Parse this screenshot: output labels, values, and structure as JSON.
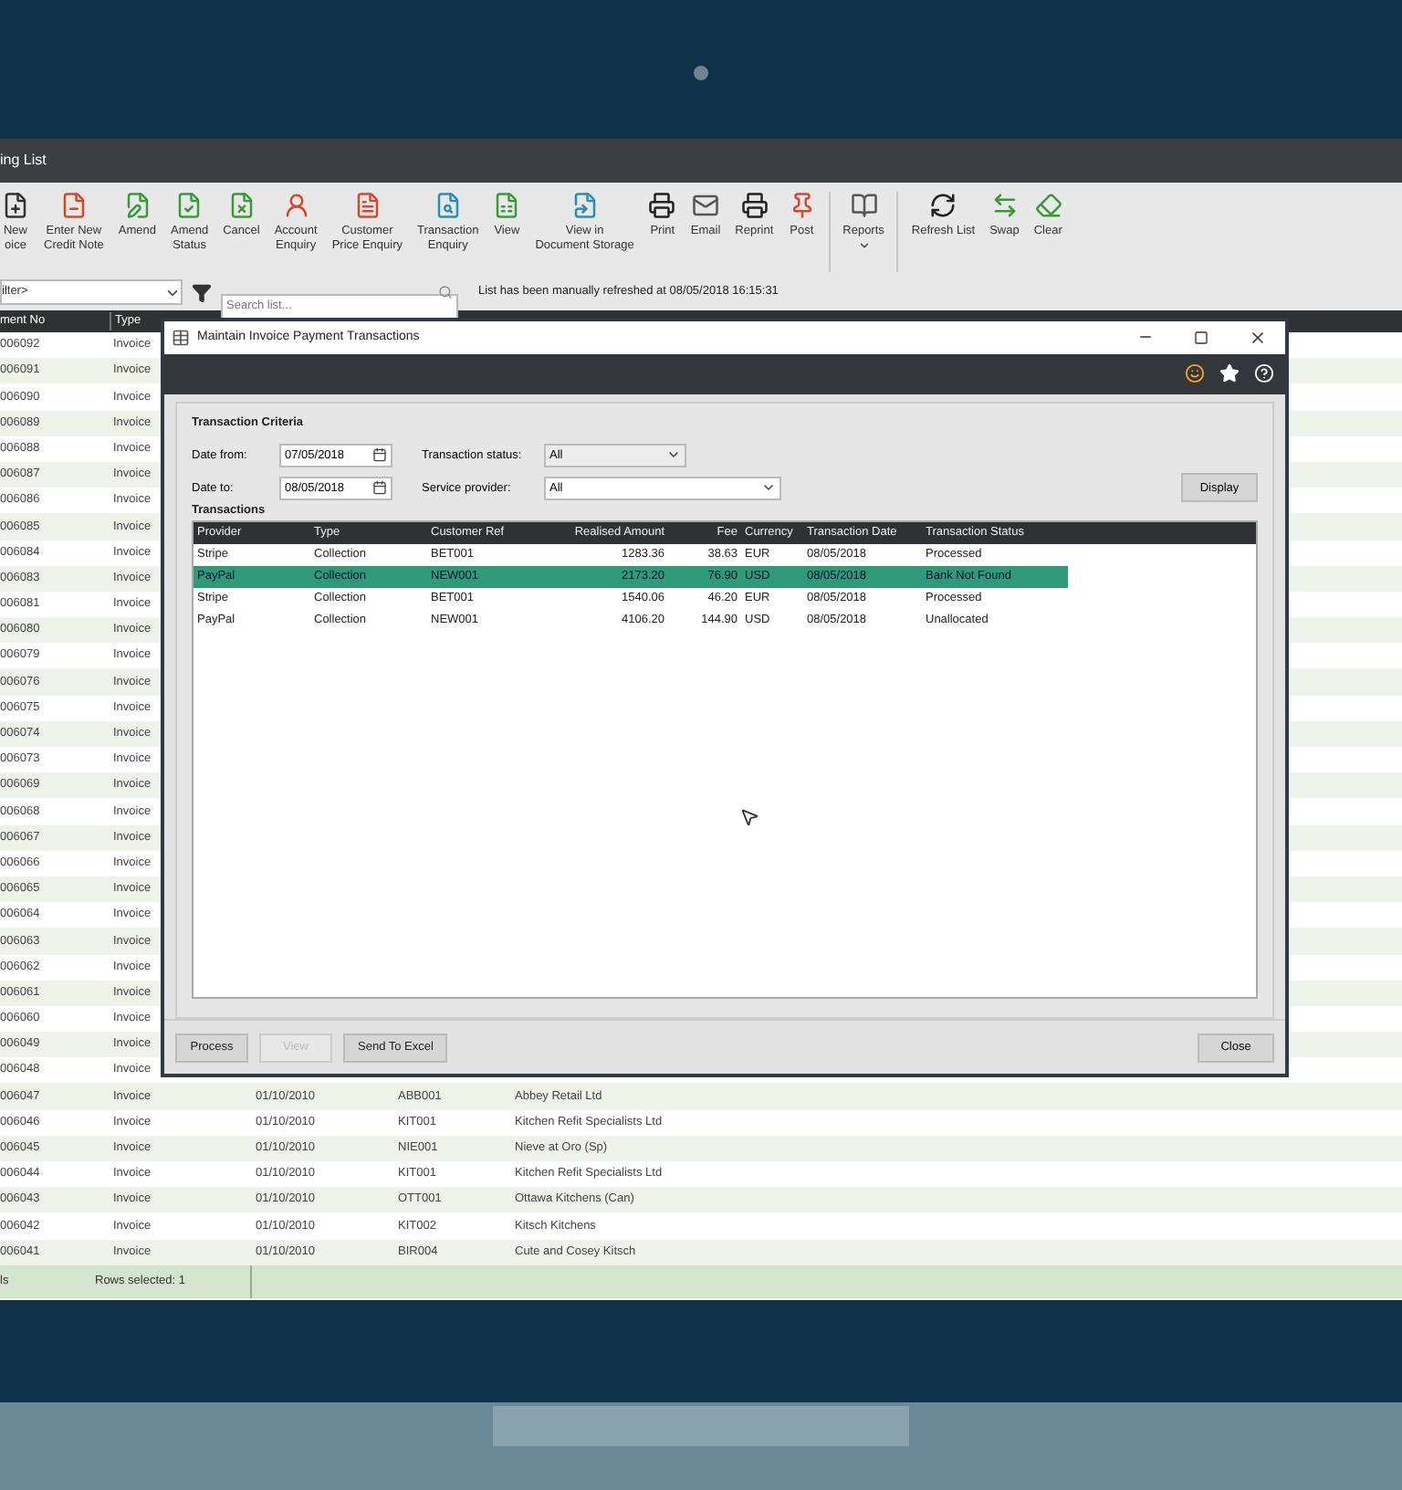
{
  "window": {
    "title": "ing List"
  },
  "toolbar": [
    {
      "label": "New\noice",
      "dropdown": false
    },
    {
      "label": "Enter New\nCredit Note",
      "dropdown": false
    },
    {
      "label": "Amend",
      "dropdown": false
    },
    {
      "label": "Amend\nStatus",
      "dropdown": false
    },
    {
      "label": "Cancel",
      "dropdown": false
    },
    {
      "label": "Account\nEnquiry",
      "dropdown": false
    },
    {
      "label": "Customer\nPrice Enquiry",
      "dropdown": false
    },
    {
      "label": "Transaction\nEnquiry",
      "dropdown": false
    },
    {
      "label": "View",
      "dropdown": false
    },
    {
      "label": "View in\nDocument Storage",
      "dropdown": false
    },
    {
      "label": "Print",
      "dropdown": false
    },
    {
      "label": "Email",
      "dropdown": false
    },
    {
      "label": "Reprint",
      "dropdown": false
    },
    {
      "label": "Post",
      "dropdown": false
    },
    {
      "label": "Reports",
      "dropdown": true
    },
    {
      "label": "Refresh List",
      "dropdown": false
    },
    {
      "label": "Swap",
      "dropdown": false
    },
    {
      "label": "Clear",
      "dropdown": false
    }
  ],
  "filter": {
    "value": "ilter>"
  },
  "search": {
    "placeholder": "Search list..."
  },
  "refresh_message": "List has been manually refreshed at 08/05/2018 16:15:31",
  "list": {
    "columns": [
      "ment No",
      "Type"
    ],
    "rows": [
      {
        "number": "006092",
        "type": "Invoice"
      },
      {
        "number": "006091",
        "type": "Invoice"
      },
      {
        "number": "006090",
        "type": "Invoice"
      },
      {
        "number": "006089",
        "type": "Invoice"
      },
      {
        "number": "006088",
        "type": "Invoice"
      },
      {
        "number": "006087",
        "type": "Invoice"
      },
      {
        "number": "006086",
        "type": "Invoice"
      },
      {
        "number": "006085",
        "type": "Invoice"
      },
      {
        "number": "006084",
        "type": "Invoice"
      },
      {
        "number": "006083",
        "type": "Invoice"
      },
      {
        "number": "006081",
        "type": "Invoice"
      },
      {
        "number": "006080",
        "type": "Invoice"
      },
      {
        "number": "006079",
        "type": "Invoice"
      },
      {
        "number": "006076",
        "type": "Invoice"
      },
      {
        "number": "006075",
        "type": "Invoice"
      },
      {
        "number": "006074",
        "type": "Invoice"
      },
      {
        "number": "006073",
        "type": "Invoice"
      },
      {
        "number": "006069",
        "type": "Invoice"
      },
      {
        "number": "006068",
        "type": "Invoice"
      },
      {
        "number": "006067",
        "type": "Invoice"
      },
      {
        "number": "006066",
        "type": "Invoice"
      },
      {
        "number": "006065",
        "type": "Invoice"
      },
      {
        "number": "006064",
        "type": "Invoice"
      },
      {
        "number": "006063",
        "type": "Invoice"
      },
      {
        "number": "006062",
        "type": "Invoice"
      },
      {
        "number": "006061",
        "type": "Invoice"
      },
      {
        "number": "006060",
        "type": "Invoice"
      },
      {
        "number": "006049",
        "type": "Invoice"
      },
      {
        "number": "006048",
        "type": "Invoice"
      },
      {
        "number": "006047",
        "type": "Invoice",
        "date": "01/10/2010",
        "account": "ABB001",
        "name": "Abbey Retail Ltd"
      },
      {
        "number": "006046",
        "type": "Invoice",
        "date": "01/10/2010",
        "account": "KIT001",
        "name": "Kitchen Refit Specialists Ltd"
      },
      {
        "number": "006045",
        "type": "Invoice",
        "date": "01/10/2010",
        "account": "NIE001",
        "name": "Nieve at Oro (Sp)"
      },
      {
        "number": "006044",
        "type": "Invoice",
        "date": "01/10/2010",
        "account": "KIT001",
        "name": "Kitchen Refit Specialists Ltd"
      },
      {
        "number": "006043",
        "type": "Invoice",
        "date": "01/10/2010",
        "account": "OTT001",
        "name": "Ottawa Kitchens (Can)"
      },
      {
        "number": "006042",
        "type": "Invoice",
        "date": "01/10/2010",
        "account": "KIT002",
        "name": "Kitsch Kitchens"
      },
      {
        "number": "006041",
        "type": "Invoice",
        "date": "01/10/2010",
        "account": "BIR004",
        "name": "Cute and Cosey Kitsch"
      }
    ]
  },
  "status_bar": [
    "ls",
    "Rows selected: 1"
  ],
  "dialog": {
    "title": "Maintain Invoice Payment Transactions",
    "criteria": {
      "heading": "Transaction Criteria",
      "date_from": {
        "label": "Date from:",
        "value": "07/05/2018"
      },
      "date_to": {
        "label": "Date to:",
        "value": "08/05/2018"
      },
      "transaction_status": {
        "label": "Transaction status:",
        "value": "All"
      },
      "service_provider": {
        "label": "Service provider:",
        "value": "All"
      },
      "display_button": "Display"
    },
    "transactions": {
      "heading": "Transactions",
      "columns": [
        "Provider",
        "Type",
        "Customer Ref",
        "Realised Amount",
        "Fee",
        "Currency",
        "Transaction Date",
        "Transaction Status"
      ],
      "rows": [
        {
          "selected": false,
          "cells": [
            "Stripe",
            "Collection",
            "BET001",
            "1283.36",
            "38.63",
            "EUR",
            "08/05/2018",
            "Processed"
          ]
        },
        {
          "selected": true,
          "cells": [
            "PayPal",
            "Collection",
            "NEW001",
            "2173.20",
            "76.90",
            "USD",
            "08/05/2018",
            "Bank Not Found"
          ]
        },
        {
          "selected": false,
          "cells": [
            "Stripe",
            "Collection",
            "BET001",
            "1540.06",
            "46.20",
            "EUR",
            "08/05/2018",
            "Processed"
          ]
        },
        {
          "selected": false,
          "cells": [
            "PayPal",
            "Collection",
            "NEW001",
            "4106.20",
            "144.90",
            "USD",
            "08/05/2018",
            "Unallocated"
          ]
        }
      ]
    },
    "buttons": [
      {
        "label": "Process",
        "disabled": false
      },
      {
        "label": "View",
        "disabled": true
      },
      {
        "label": "Send To Excel",
        "disabled": false
      }
    ],
    "close_button": "Close"
  }
}
